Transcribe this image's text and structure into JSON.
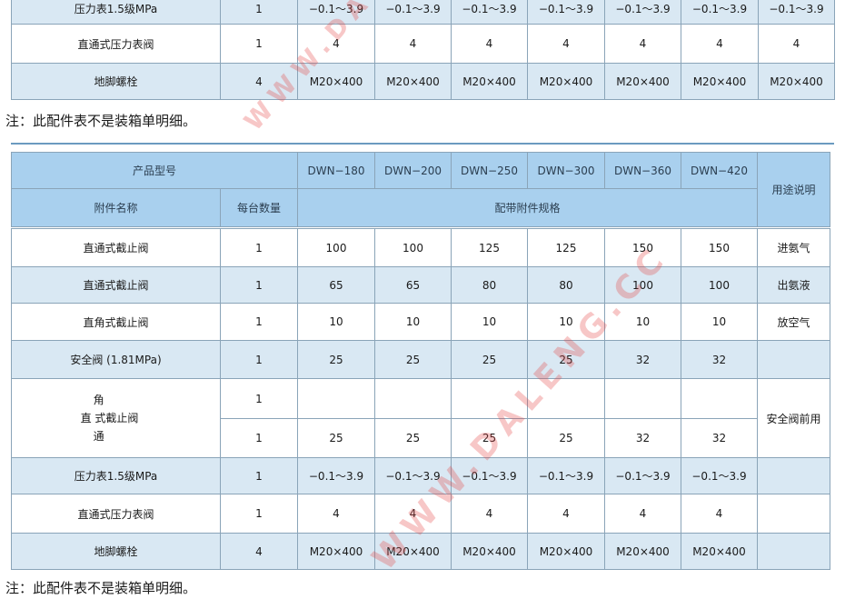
{
  "table1": {
    "rows": [
      {
        "name": "压力表1.5级MPa",
        "qty": "1",
        "specs": [
          "−0.1～3.9",
          "−0.1～3.9",
          "−0.1～3.9",
          "−0.1～3.9",
          "−0.1～3.9",
          "−0.1～3.9",
          "−0.1～3.9"
        ]
      },
      {
        "name": "直通式压力表阀",
        "qty": "1",
        "specs": [
          "4",
          "4",
          "4",
          "4",
          "4",
          "4",
          "4"
        ]
      },
      {
        "name": "地脚螺栓",
        "qty": "4",
        "specs": [
          "M20×400",
          "M20×400",
          "M20×400",
          "M20×400",
          "M20×400",
          "M20×400",
          "M20×400"
        ]
      }
    ]
  },
  "note1": "注：此配件表不是装箱单明细。",
  "table2": {
    "header": {
      "model_label": "产品型号",
      "models": [
        "DWN−180",
        "DWN−200",
        "DWN−250",
        "DWN−300",
        "DWN−360",
        "DWN−420"
      ],
      "usage_label": "用途说明",
      "name_label": "附件名称",
      "qty_label": "每台数量",
      "spec_label": "配带附件规格"
    },
    "rows": [
      {
        "name": "直通式截止阀",
        "qty": "1",
        "specs": [
          "100",
          "100",
          "125",
          "125",
          "150",
          "150"
        ],
        "usage": "进氨气"
      },
      {
        "name": "直通式截止阀",
        "qty": "1",
        "specs": [
          "65",
          "65",
          "80",
          "80",
          "100",
          "100"
        ],
        "usage": "出氨液"
      },
      {
        "name": "直角式截止阀",
        "qty": "1",
        "specs": [
          "10",
          "10",
          "10",
          "10",
          "10",
          "10"
        ],
        "usage": "放空气"
      },
      {
        "name": "安全阀 (1.81MPa)",
        "qty": "1",
        "specs": [
          "25",
          "25",
          "25",
          "25",
          "32",
          "32"
        ],
        "usage": ""
      }
    ],
    "angle_row": {
      "name_top": "角",
      "name_mid": "直  式截止阀",
      "name_bottom": "通",
      "qty_a": "1",
      "qty_b": "1",
      "specs_a": [
        "",
        "",
        "",
        "",
        "",
        ""
      ],
      "specs_b": [
        "25",
        "25",
        "25",
        "25",
        "32",
        "32"
      ],
      "usage": "安全阀前用"
    },
    "rows_after": [
      {
        "name": "压力表1.5级MPa",
        "qty": "1",
        "specs": [
          "−0.1～3.9",
          "−0.1～3.9",
          "−0.1～3.9",
          "−0.1～3.9",
          "−0.1～3.9",
          "−0.1～3.9"
        ],
        "usage": ""
      },
      {
        "name": "直通式压力表阀",
        "qty": "1",
        "specs": [
          "4",
          "4",
          "4",
          "4",
          "4",
          "4"
        ],
        "usage": ""
      },
      {
        "name": "地脚螺栓",
        "qty": "4",
        "specs": [
          "M20×400",
          "M20×400",
          "M20×400",
          "M20×400",
          "M20×400",
          "M20×400"
        ],
        "usage": ""
      }
    ]
  },
  "note2": "注：此配件表不是装箱单明细。",
  "watermark": "WWW.DALENG.CC"
}
